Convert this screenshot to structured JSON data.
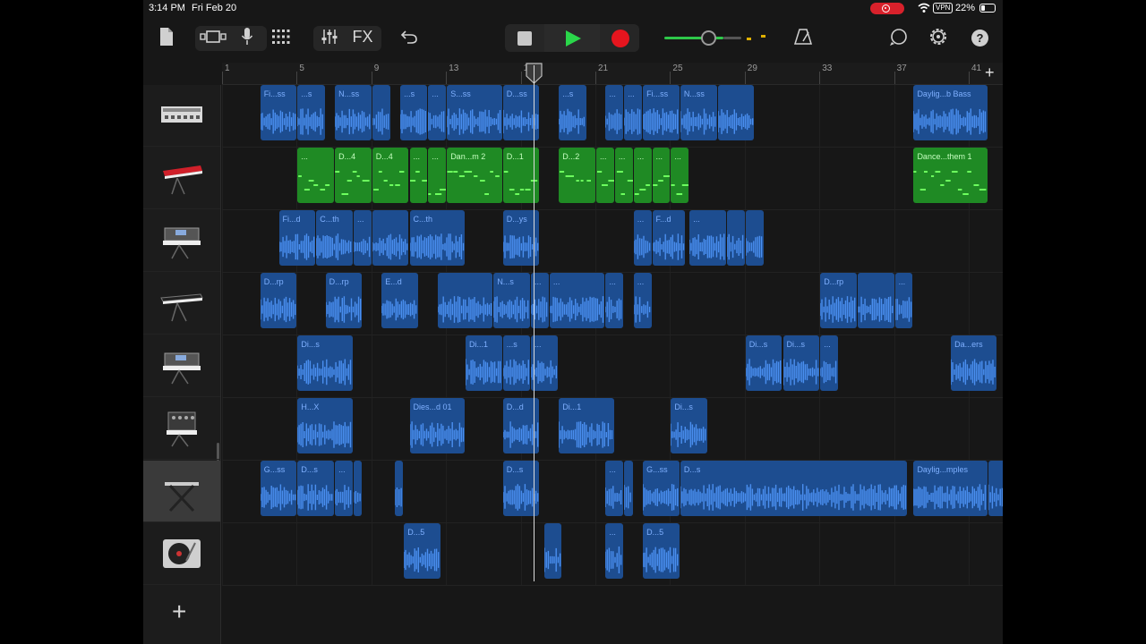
{
  "status_bar": {
    "time": "3:14 PM",
    "date": "Fri Feb 20",
    "vpn": "VPN",
    "battery": "22%"
  },
  "toolbar": {
    "my_songs_icon": "document-icon",
    "view_icon": "track-view-icon",
    "mic_icon": "microphone-icon",
    "grid_icon": "grid-icon",
    "mixer_icon": "mixer-icon",
    "fx_label": "FX",
    "undo_icon": "undo-icon",
    "stop_icon": "stop-icon",
    "play_icon": "play-icon",
    "record_icon": "record-icon",
    "master_volume": 0.77,
    "metronome_icon": "metronome-icon",
    "loop_icon": "loop-icon",
    "settings_icon": "gear-icon",
    "help_label": "?"
  },
  "ruler": {
    "bars": [
      "1",
      "5",
      "9",
      "13",
      "17",
      "21",
      "25",
      "29",
      "33",
      "37",
      "41"
    ],
    "add_label": "+"
  },
  "playhead_bar": 17.7,
  "tracks": [
    {
      "instrument": "drum-machine-icon",
      "selected": false,
      "regions": [
        {
          "label": "Fi...ss",
          "type": "audio"
        },
        {
          "label": "...s",
          "type": "audio"
        },
        {
          "label": "N...ss",
          "type": "audio"
        },
        {
          "label": "",
          "type": "audio"
        },
        {
          "label": "...s",
          "type": "audio"
        },
        {
          "label": "...",
          "type": "audio"
        },
        {
          "label": "S...ss",
          "type": "audio"
        },
        {
          "label": "D...ss",
          "type": "audio"
        },
        {
          "label": "...s",
          "type": "audio"
        },
        {
          "label": "...",
          "type": "audio"
        },
        {
          "label": "...",
          "type": "audio"
        },
        {
          "label": "Fi...ss",
          "type": "audio"
        },
        {
          "label": "N...ss",
          "type": "audio"
        },
        {
          "label": "",
          "type": "audio"
        },
        {
          "label": "Daylig...b Bass",
          "type": "audio"
        }
      ]
    },
    {
      "instrument": "red-keyboard-icon",
      "selected": false,
      "regions": [
        {
          "label": "...",
          "type": "midi"
        },
        {
          "label": "D...4",
          "type": "midi"
        },
        {
          "label": "D...4",
          "type": "midi"
        },
        {
          "label": "...",
          "type": "midi"
        },
        {
          "label": "...",
          "type": "midi"
        },
        {
          "label": "Dan...m 2",
          "type": "midi"
        },
        {
          "label": "D...1",
          "type": "midi"
        },
        {
          "label": "D...2",
          "type": "midi"
        },
        {
          "label": "...",
          "type": "midi"
        },
        {
          "label": "...",
          "type": "midi"
        },
        {
          "label": "...",
          "type": "midi"
        },
        {
          "label": "...",
          "type": "midi"
        },
        {
          "label": "...",
          "type": "midi"
        },
        {
          "label": "Dance...them 1",
          "type": "midi"
        }
      ]
    },
    {
      "instrument": "synth-keyboard-icon",
      "selected": false,
      "regions": [
        {
          "label": "Fi...d",
          "type": "audio"
        },
        {
          "label": "C...th",
          "type": "audio"
        },
        {
          "label": "...",
          "type": "audio"
        },
        {
          "label": "",
          "type": "audio"
        },
        {
          "label": "C...th",
          "type": "audio"
        },
        {
          "label": "D...ys",
          "type": "audio"
        },
        {
          "label": "...",
          "type": "audio"
        },
        {
          "label": "F...d",
          "type": "audio"
        },
        {
          "label": "...",
          "type": "audio"
        },
        {
          "label": "",
          "type": "audio"
        },
        {
          "label": "",
          "type": "audio"
        }
      ]
    },
    {
      "instrument": "keyboard-icon",
      "selected": false,
      "regions": [
        {
          "label": "D...rp",
          "type": "audio"
        },
        {
          "label": "D...rp",
          "type": "audio"
        },
        {
          "label": "E...d",
          "type": "audio"
        },
        {
          "label": "",
          "type": "audio"
        },
        {
          "label": "N...s",
          "type": "audio"
        },
        {
          "label": "...",
          "type": "audio"
        },
        {
          "label": "...",
          "type": "audio"
        },
        {
          "label": "...",
          "type": "audio"
        },
        {
          "label": "...",
          "type": "audio"
        },
        {
          "label": "D...rp",
          "type": "audio"
        },
        {
          "label": "",
          "type": "audio"
        },
        {
          "label": "...",
          "type": "audio"
        }
      ]
    },
    {
      "instrument": "synth-keyboard-icon",
      "selected": false,
      "regions": [
        {
          "label": "Di...s",
          "type": "audio"
        },
        {
          "label": "Di...1",
          "type": "audio"
        },
        {
          "label": "...s",
          "type": "audio"
        },
        {
          "label": "...",
          "type": "audio"
        },
        {
          "label": "Di...s",
          "type": "audio"
        },
        {
          "label": "Di...s",
          "type": "audio"
        },
        {
          "label": "...",
          "type": "audio"
        },
        {
          "label": "Da...ers",
          "type": "audio"
        }
      ]
    },
    {
      "instrument": "modular-synth-icon",
      "selected": false,
      "regions": [
        {
          "label": "H...X",
          "type": "audio"
        },
        {
          "label": "Dies...d 01",
          "type": "audio"
        },
        {
          "label": "D...d",
          "type": "audio"
        },
        {
          "label": "Di...1",
          "type": "audio"
        },
        {
          "label": "Di...s",
          "type": "audio"
        }
      ]
    },
    {
      "instrument": "keyboard-stand-icon",
      "selected": true,
      "regions": [
        {
          "label": "G...ss",
          "type": "audio"
        },
        {
          "label": "D...s",
          "type": "audio"
        },
        {
          "label": "...",
          "type": "audio"
        },
        {
          "label": "",
          "type": "audio"
        },
        {
          "label": "",
          "type": "audio"
        },
        {
          "label": "D...s",
          "type": "audio"
        },
        {
          "label": "...",
          "type": "audio"
        },
        {
          "label": "",
          "type": "audio"
        },
        {
          "label": "G...ss",
          "type": "audio"
        },
        {
          "label": "D...s",
          "type": "audio"
        },
        {
          "label": "Daylig...mples",
          "type": "audio"
        },
        {
          "label": "",
          "type": "audio"
        }
      ]
    },
    {
      "instrument": "turntable-icon",
      "selected": false,
      "regions": [
        {
          "label": "D...5",
          "type": "audio"
        },
        {
          "label": "",
          "type": "audio"
        },
        {
          "label": "...",
          "type": "audio"
        },
        {
          "label": "D...5",
          "type": "audio"
        }
      ]
    }
  ],
  "add_track_label": "+",
  "colors": {
    "audio_region": "#1d4d90",
    "midi_region": "#1f8a24",
    "play": "#2ad64a",
    "record": "#e6151e"
  }
}
